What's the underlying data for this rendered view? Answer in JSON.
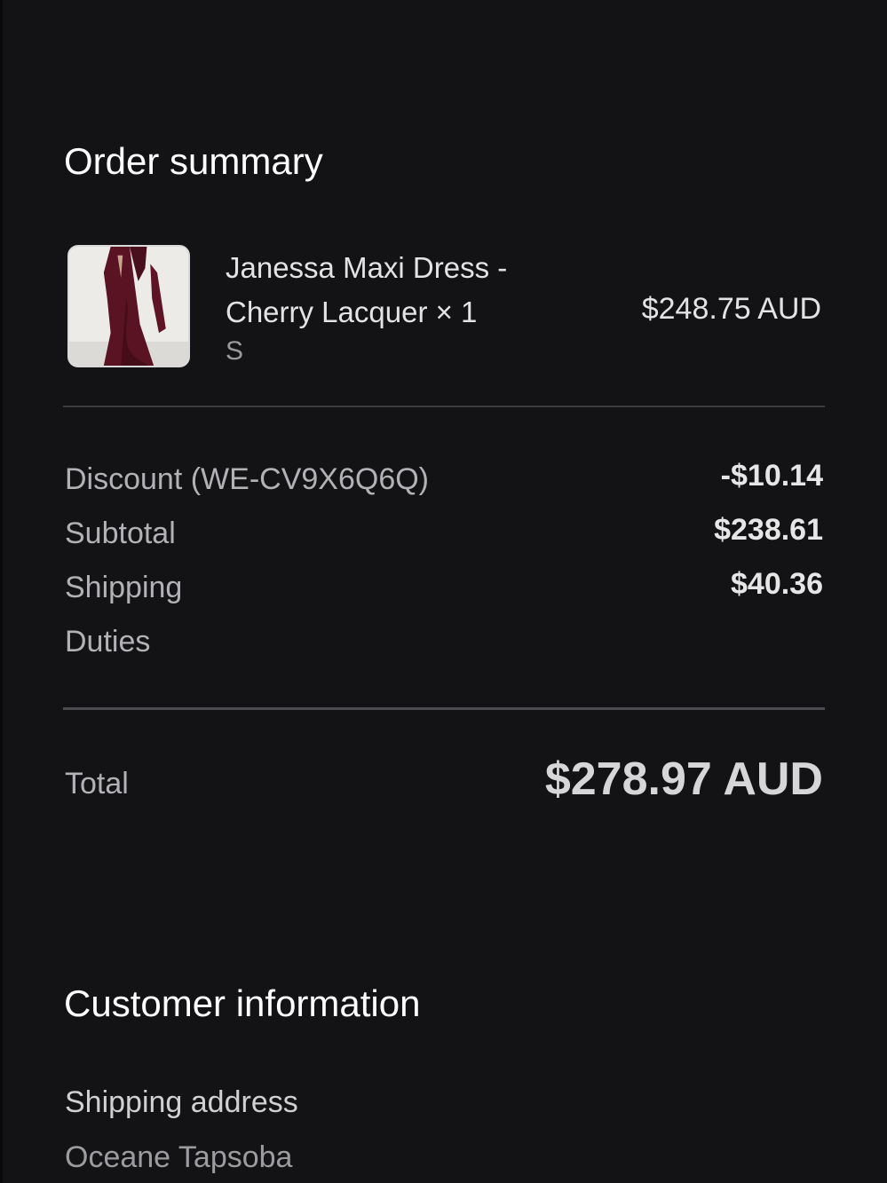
{
  "order_summary": {
    "title": "Order summary",
    "item": {
      "name": "Janessa Maxi Dress - Cherry Lacquer × 1",
      "variant": "S",
      "price": "$248.75 AUD",
      "image_icon": "dress-thumbnail"
    },
    "lines": {
      "discount_label": "Discount (WE-CV9X6Q6Q)",
      "discount_value": "-$10.14",
      "subtotal_label": "Subtotal",
      "subtotal_value": "$238.61",
      "shipping_label": "Shipping",
      "shipping_value": "$40.36",
      "duties_label": "Duties"
    },
    "total_label": "Total",
    "total_value": "$278.97 AUD"
  },
  "customer_information": {
    "title": "Customer information",
    "shipping_address_label": "Shipping address",
    "shipping_address_name": "Oceane Tapsoba"
  },
  "colors": {
    "background": "#131315",
    "dress": "#5a1322"
  }
}
